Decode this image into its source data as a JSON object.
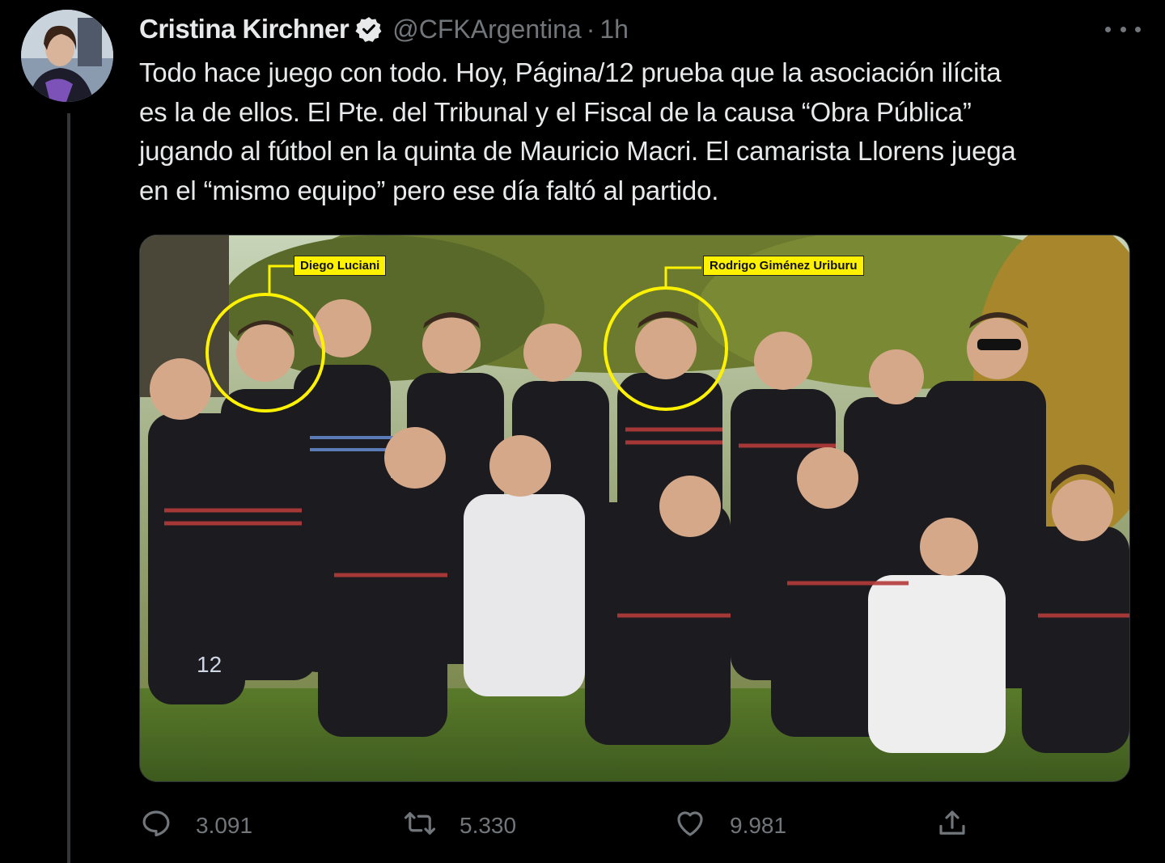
{
  "tweet": {
    "display_name": "Cristina Kirchner",
    "handle": "@CFKArgentina",
    "separator": "·",
    "time": "1h",
    "text": "Todo hace juego con todo. Hoy, Página/12 prueba que la asociación ilícita\nes la de ellos. El Pte. del Tribunal y el Fiscal de la causa “Obra Pública”\njugando al fútbol en la quinta de Mauricio Macri. El camarista Llorens juega\nen el “mismo equipo” pero ese día faltó al partido."
  },
  "media": {
    "labels": {
      "left": "Diego Luciani",
      "right": "Rodrigo Giménez Uriburu"
    },
    "jersey_number": "12"
  },
  "actions": {
    "replies": "3.091",
    "retweets": "5.330",
    "likes": "9.981"
  },
  "colors": {
    "background": "#000000",
    "text": "#e7e9ea",
    "muted": "#71767b",
    "highlight": "#fff200"
  },
  "icons": [
    "verified-badge-icon",
    "more-icon",
    "reply-icon",
    "retweet-icon",
    "like-icon",
    "share-icon"
  ]
}
